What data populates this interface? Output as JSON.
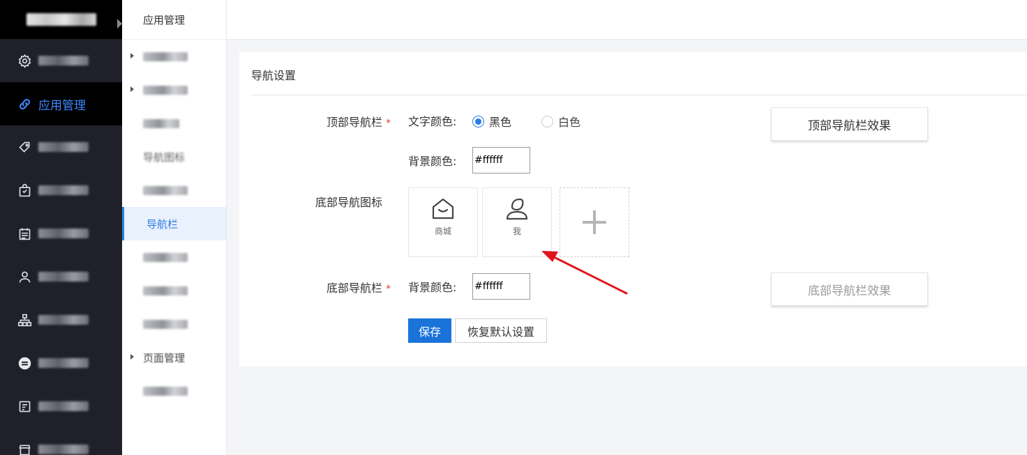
{
  "colors": {
    "accent": "#2f7be5",
    "primary_button": "#1a73d9",
    "required": "#e4393c",
    "sidebar_bg": "#1f2029",
    "arrow": "#e0141e"
  },
  "sidebar": {
    "items": [
      {
        "icon": "gear-icon"
      },
      {
        "icon": "link-icon",
        "label": "应用管理"
      },
      {
        "icon": "tag-icon"
      },
      {
        "icon": "bag-icon"
      },
      {
        "icon": "calendar-icon"
      },
      {
        "icon": "user-icon"
      },
      {
        "icon": "org-chart-icon"
      },
      {
        "icon": "circle-minus-icon"
      },
      {
        "icon": "document-icon"
      },
      {
        "icon": "store-icon"
      }
    ]
  },
  "submenu": {
    "title": "应用管理",
    "items": [
      {
        "label": ""
      },
      {
        "label": ""
      },
      {
        "label": ""
      },
      {
        "label": "导航图标"
      },
      {
        "label": ""
      },
      {
        "label": "导航栏"
      },
      {
        "label": ""
      },
      {
        "label": ""
      },
      {
        "label": ""
      },
      {
        "label": "页面管理"
      },
      {
        "label": ""
      }
    ]
  },
  "card": {
    "title": "导航设置",
    "top_nav": {
      "label": "顶部导航栏",
      "required_mark": "*",
      "text_color_label": "文字颜色:",
      "option_black": "黑色",
      "option_white": "白色",
      "selected": "黑色",
      "bg_color_label": "背景颜色:",
      "bg_color_value": "#ffffff",
      "preview_button": "顶部导航栏效果"
    },
    "bottom_icons": {
      "label": "底部导航图标",
      "items": [
        {
          "caption": "商城",
          "icon": "home-smile-icon"
        },
        {
          "caption": "我",
          "icon": "person-icon"
        }
      ],
      "add_icon": "plus-icon"
    },
    "bottom_nav": {
      "label": "底部导航栏",
      "required_mark": "*",
      "bg_color_label": "背景颜色:",
      "bg_color_value": "#ffffff",
      "preview_button": "底部导航栏效果"
    },
    "actions": {
      "save": "保存",
      "reset": "恢复默认设置"
    }
  }
}
